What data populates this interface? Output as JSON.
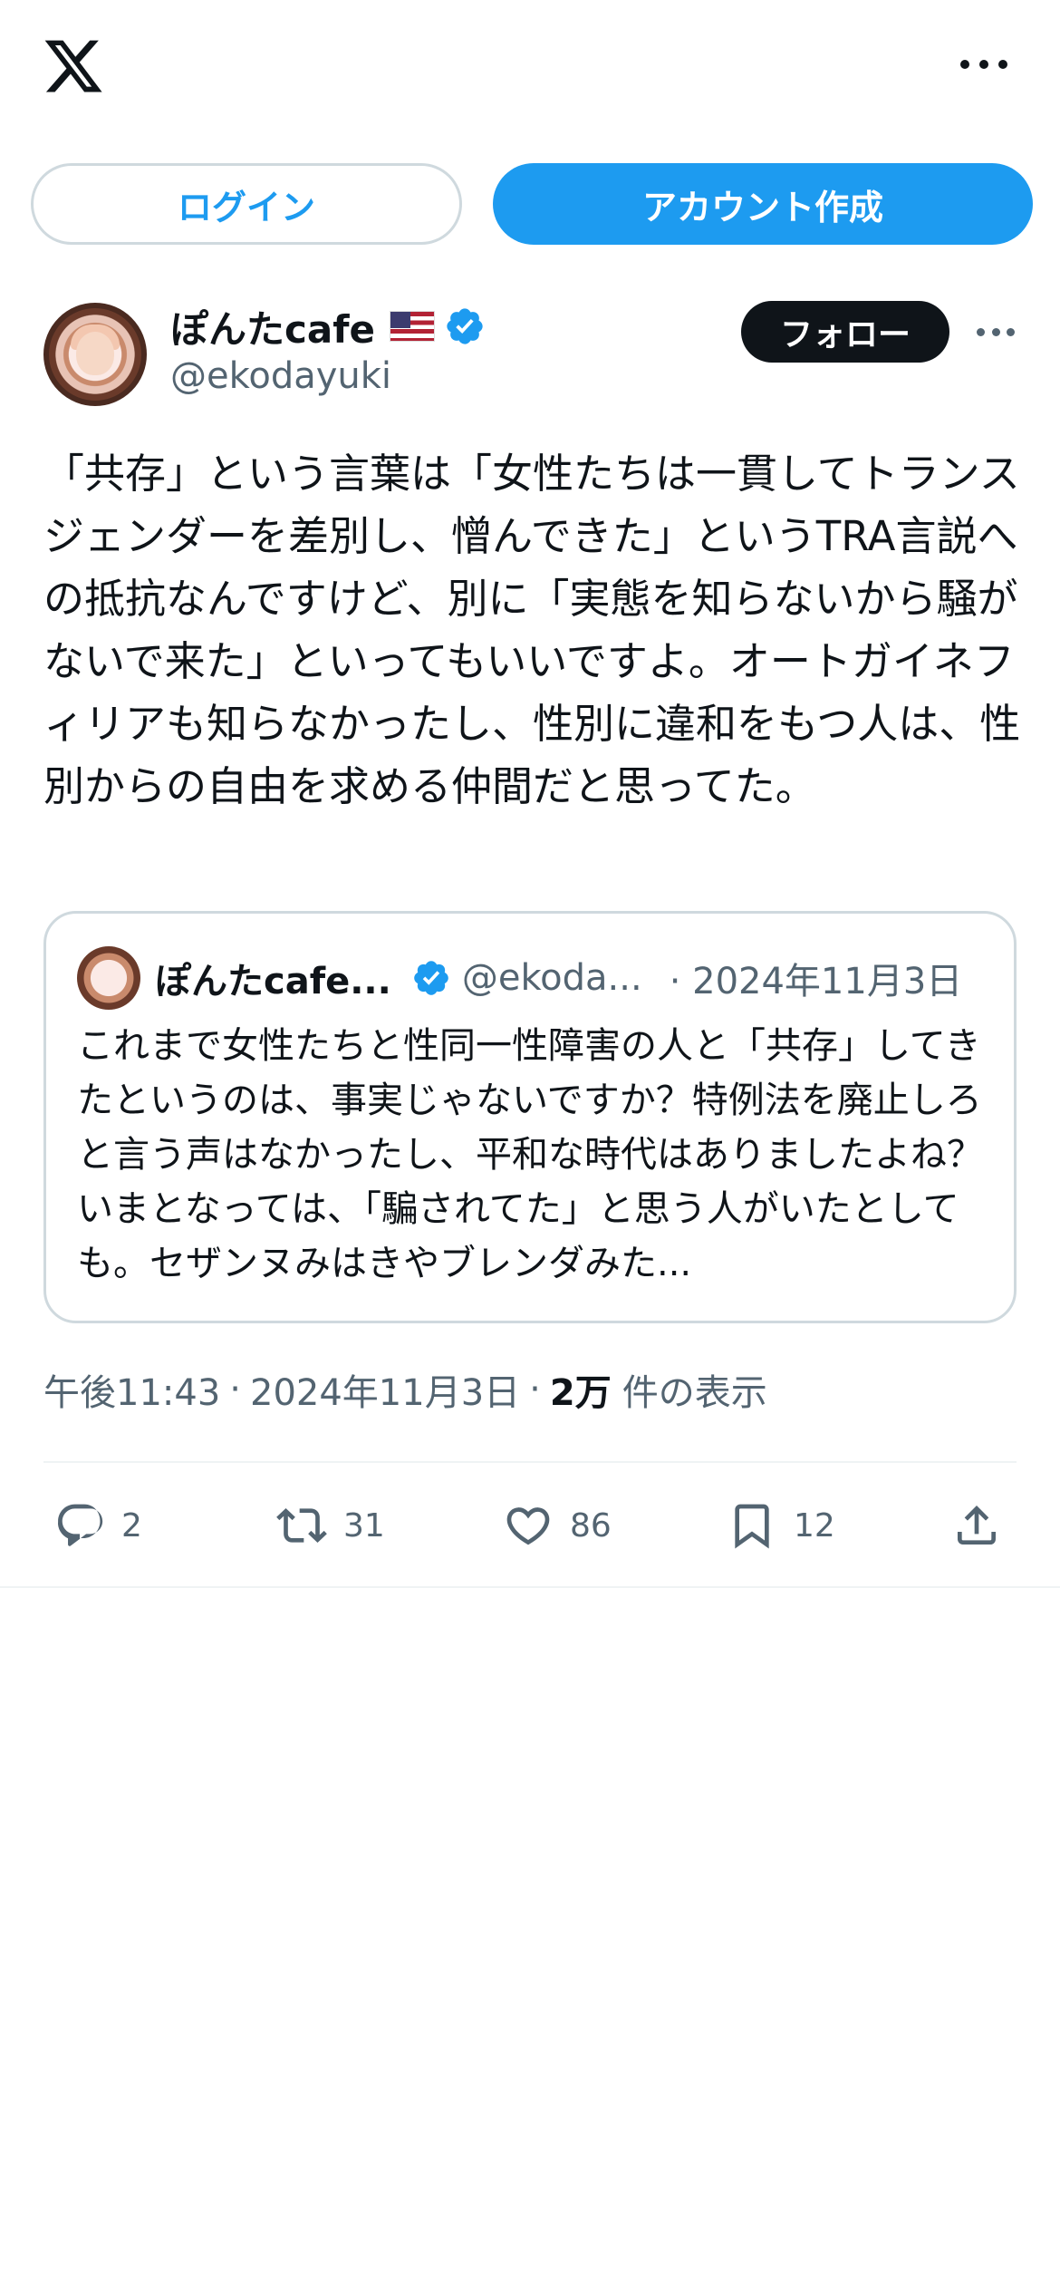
{
  "header": {
    "logo_icon": "x-logo-icon",
    "more_icon": "more-horizontal-icon"
  },
  "auth": {
    "login_label": "ログイン",
    "signup_label": "アカウント作成"
  },
  "tweet": {
    "author": {
      "display_name": "ぽんたcafe",
      "flag_icon": "us-flag-icon",
      "verified_icon": "verified-badge-icon",
      "handle": "@ekodayuki"
    },
    "follow_label": "フォロー",
    "text": "「共存」という言葉は「女性たちは一貫してトランスジェンダーを差別し、憎んできた」というTRA言説への抵抗なんですけど、別に「実態を知らないから騒がないで来た」といってもいいですよ。オートガイネフィリアも知らなかったし、性別に違和をもつ人は、性別からの自由を求める仲間だと思ってた。",
    "quote": {
      "display_name": "ぽんたcafe...",
      "handle": "@ekoda...",
      "date": "· 2024年11月3日",
      "text": "これまで女性たちと性同一性障害の人と「共存」してきたというのは、事実じゃないですか？特例法を廃止しろと言う声はなかったし、平和な時代はありましたよね？いまとなっては、「騙されてた」と思う人がいたとしても。セザンヌみはきやブレンダみた..."
    },
    "meta": {
      "time": "午後11:43",
      "date": "2024年11月3日",
      "views_count": "2万",
      "views_label": "件の表示"
    },
    "actions": {
      "replies": "2",
      "reposts": "31",
      "likes": "86",
      "bookmarks": "12"
    }
  },
  "colors": {
    "accent": "#1d9bf0",
    "text_primary": "#0f1419",
    "text_secondary": "#536471",
    "border": "#cfd9de"
  }
}
